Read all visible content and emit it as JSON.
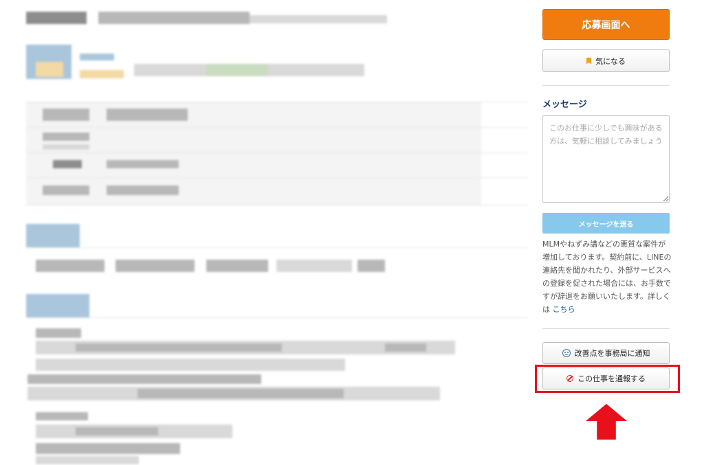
{
  "sidebar": {
    "apply_label": "応募画面へ",
    "bookmark_label": "気になる",
    "bookmark_icon": "bookmark-icon",
    "message_title": "メッセージ",
    "message_placeholder": "このお仕事に少しでも興味がある方は、気軽に相談してみましょう",
    "message_value": "",
    "send_label": "メッセージを送る",
    "notice_text": "MLMやねずみ講などの悪質な案件が増加しております。契約前に、LINEの連絡先を聞かれたり、外部サービスへの登録を促された場合には、お手数ですが辞退をお願いいたします。詳しくは ",
    "notice_link": "こちら",
    "feedback_label": "改善点を事務局に通知",
    "feedback_icon": "smile-icon",
    "report_label": "この仕事を通報する",
    "report_icon": "ban-icon"
  },
  "annotation": {
    "highlight_color": "#e8101b",
    "arrow_icon": "up-arrow-icon"
  },
  "colors": {
    "apply": "#f07c0f",
    "send": "#86c9ec",
    "title": "#1c3d72",
    "link": "#1f5fa8"
  }
}
